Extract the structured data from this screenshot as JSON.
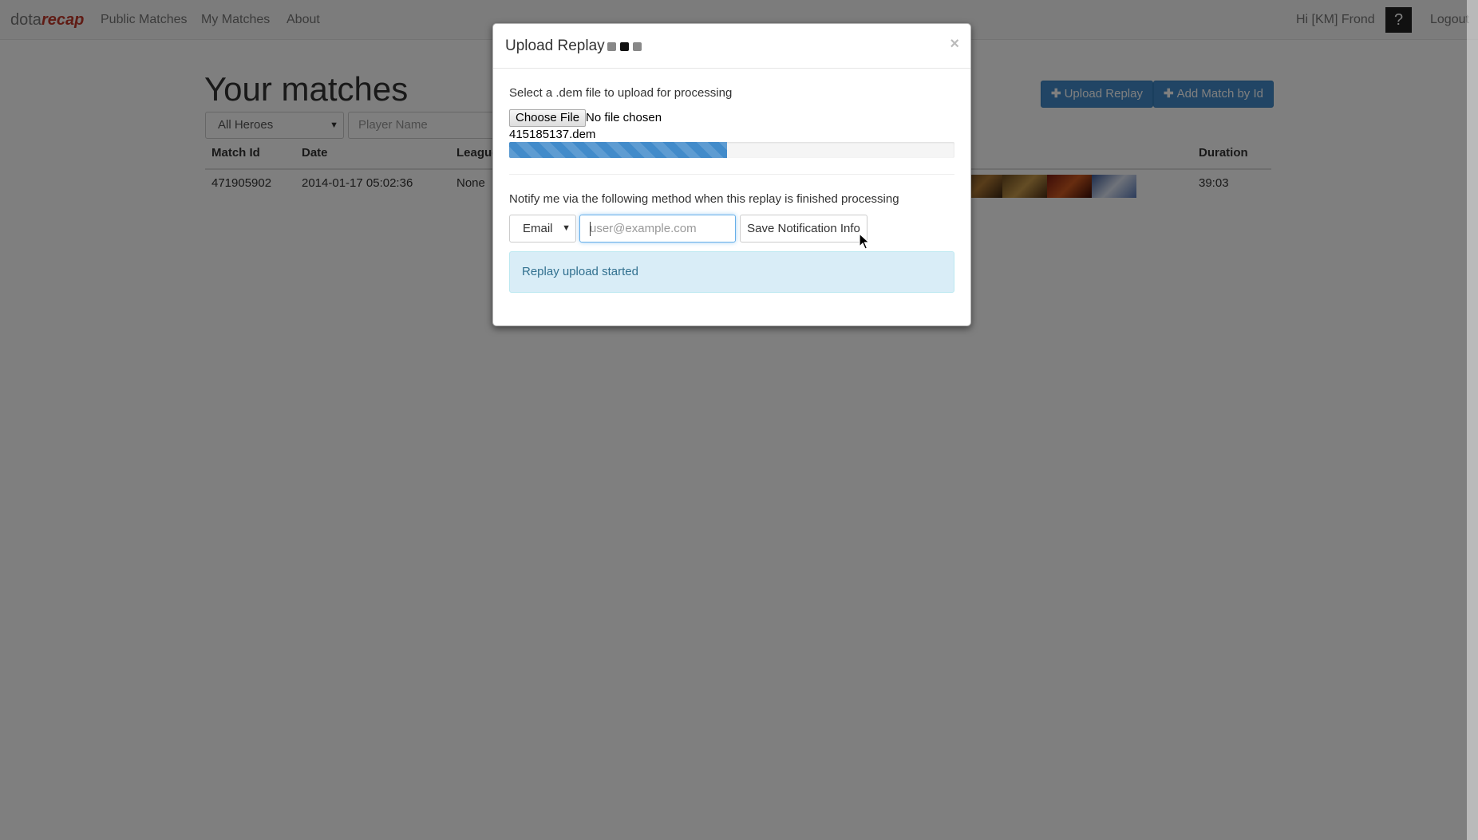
{
  "nav": {
    "brand_part1": "dota",
    "brand_part2": "recap",
    "links": [
      "Public Matches",
      "My Matches",
      "About"
    ],
    "greeting": "Hi [KM] Frond",
    "help": "?",
    "logout": "Logout"
  },
  "page": {
    "title": "Your matches",
    "upload_button": "Upload Replay",
    "add_button": "Add Match by Id",
    "hero_filter": "All Heroes",
    "player_placeholder": "Player Name"
  },
  "table": {
    "headers": [
      "Match Id",
      "Date",
      "League",
      "Duration"
    ],
    "rows": [
      {
        "match_id": "471905902",
        "date": "2014-01-17 05:02:36",
        "league": "None",
        "duration": "39:03"
      }
    ]
  },
  "modal": {
    "title": "Upload Replay",
    "close": "×",
    "instruction": "Select a .dem file to upload for processing",
    "choose_file": "Choose File",
    "no_file": "No file chosen",
    "filename": "415185137.dem",
    "progress_percent": 49,
    "notify_text": "Notify me via the following method when this replay is finished processing",
    "method": "Email",
    "email_placeholder": "user@example.com",
    "save_button": "Save Notification Info",
    "alert": "Replay upload started"
  },
  "colors": {
    "primary": "#428bca",
    "brand_accent": "#c0392b",
    "alert_bg": "#d9edf7",
    "alert_text": "#31708f"
  }
}
